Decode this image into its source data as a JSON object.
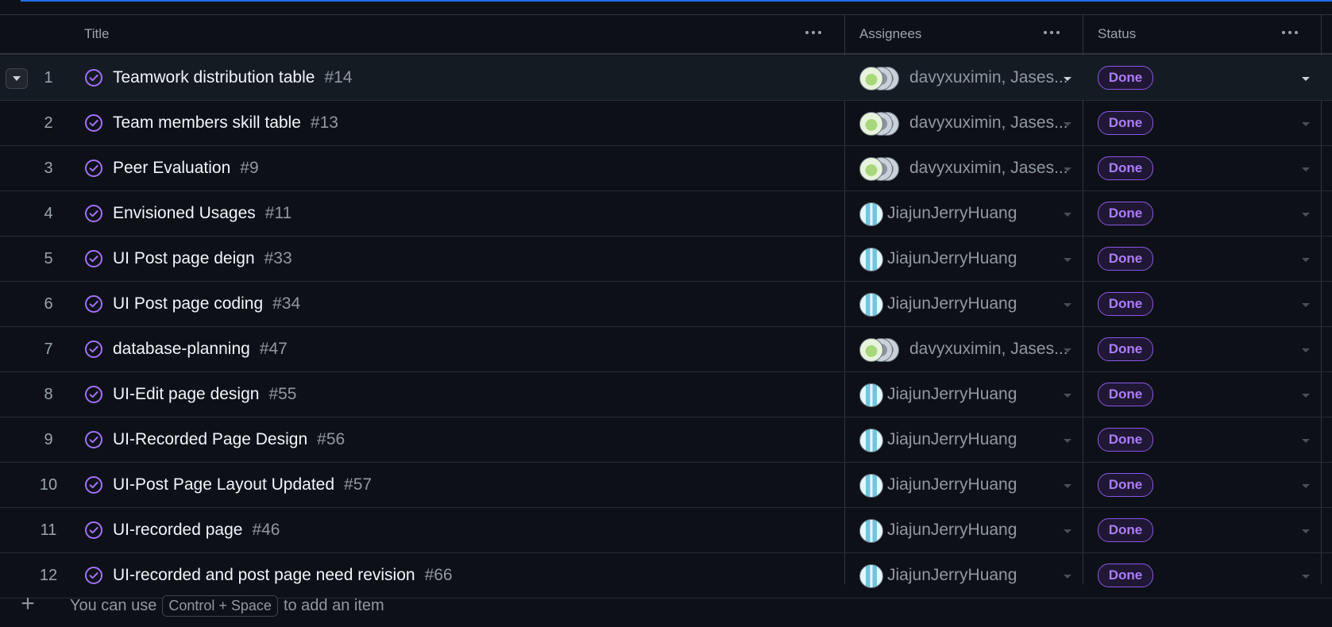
{
  "columns": {
    "title": "Title",
    "assignees": "Assignees",
    "status": "Status"
  },
  "rows": [
    {
      "num": "1",
      "title": "Teamwork distribution table",
      "issue": "#14",
      "assignees": "davyxuximin, Jases...",
      "avatars": "group",
      "status": "Done"
    },
    {
      "num": "2",
      "title": "Team members skill table",
      "issue": "#13",
      "assignees": "davyxuximin, Jases...",
      "avatars": "group",
      "status": "Done"
    },
    {
      "num": "3",
      "title": "Peer Evaluation",
      "issue": "#9",
      "assignees": "davyxuximin, Jases...",
      "avatars": "group",
      "status": "Done"
    },
    {
      "num": "4",
      "title": "Envisioned Usages",
      "issue": "#11",
      "assignees": "JiajunJerryHuang",
      "avatars": "single",
      "status": "Done"
    },
    {
      "num": "5",
      "title": "UI Post page deign",
      "issue": "#33",
      "assignees": "JiajunJerryHuang",
      "avatars": "single",
      "status": "Done"
    },
    {
      "num": "6",
      "title": "UI Post page coding",
      "issue": "#34",
      "assignees": "JiajunJerryHuang",
      "avatars": "single",
      "status": "Done"
    },
    {
      "num": "7",
      "title": "database-planning",
      "issue": "#47",
      "assignees": "davyxuximin, Jases...",
      "avatars": "group",
      "status": "Done"
    },
    {
      "num": "8",
      "title": "UI-Edit page design",
      "issue": "#55",
      "assignees": "JiajunJerryHuang",
      "avatars": "single",
      "status": "Done"
    },
    {
      "num": "9",
      "title": "UI-Recorded Page Design",
      "issue": "#56",
      "assignees": "JiajunJerryHuang",
      "avatars": "single",
      "status": "Done"
    },
    {
      "num": "10",
      "title": "UI-Post Page Layout Updated",
      "issue": "#57",
      "assignees": "JiajunJerryHuang",
      "avatars": "single",
      "status": "Done"
    },
    {
      "num": "11",
      "title": "UI-recorded page",
      "issue": "#46",
      "assignees": "JiajunJerryHuang",
      "avatars": "single",
      "status": "Done"
    },
    {
      "num": "12",
      "title": "UI-recorded and post page need revision",
      "issue": "#66",
      "assignees": "JiajunJerryHuang",
      "avatars": "single",
      "status": "Done"
    }
  ],
  "footer": {
    "prefix": "You can use",
    "shortcut": "Control + Space",
    "suffix": "to add an item"
  },
  "colors": {
    "background": "#0d1117",
    "done_badge": "#ab7df8",
    "issue_closed_icon": "#a371f7",
    "accent_line": "#1f6feb"
  },
  "icons": {
    "issue_state": "issue-closed-icon",
    "column_menu": "kebab-horizontal-icon",
    "row_menu": "triangle-down-icon",
    "add": "plus-icon"
  }
}
